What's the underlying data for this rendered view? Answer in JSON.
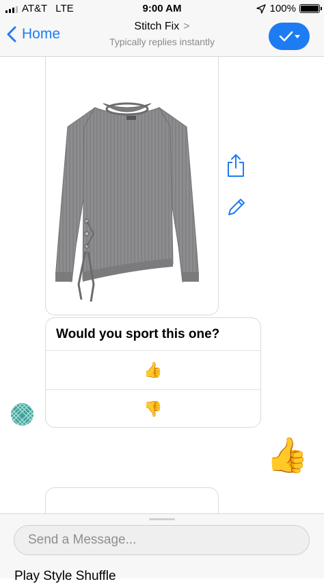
{
  "status_bar": {
    "carrier": "AT&T",
    "network": "LTE",
    "time": "9:00 AM",
    "battery": "100%",
    "icons": [
      "signal-icon",
      "location-arrow-icon",
      "battery-icon"
    ]
  },
  "nav": {
    "back_label": "Home",
    "title": "Stitch Fix",
    "title_chevron": ">",
    "subtitle": "Typically replies instantly",
    "accent_color": "#1d7cf2",
    "icons": [
      "back-chevron-icon",
      "checkmark-icon",
      "dropdown-caret-icon"
    ]
  },
  "chat": {
    "product_card": {
      "image_icon": "gray-knit-sweater-image",
      "actions": [
        "share-icon",
        "edit-pencil-icon"
      ]
    },
    "question_card": {
      "question": "Would you sport this one?",
      "options": [
        {
          "emoji": "👍",
          "icon": "thumbs-up-icon"
        },
        {
          "emoji": "👎",
          "icon": "thumbs-down-icon"
        }
      ]
    },
    "bot_avatar_icon": "stitch-fix-logo-icon",
    "sent_reply": "👍"
  },
  "composer": {
    "placeholder": "Send a Message...",
    "value": "",
    "quick_reply_label": "Play Style Shuffle"
  }
}
